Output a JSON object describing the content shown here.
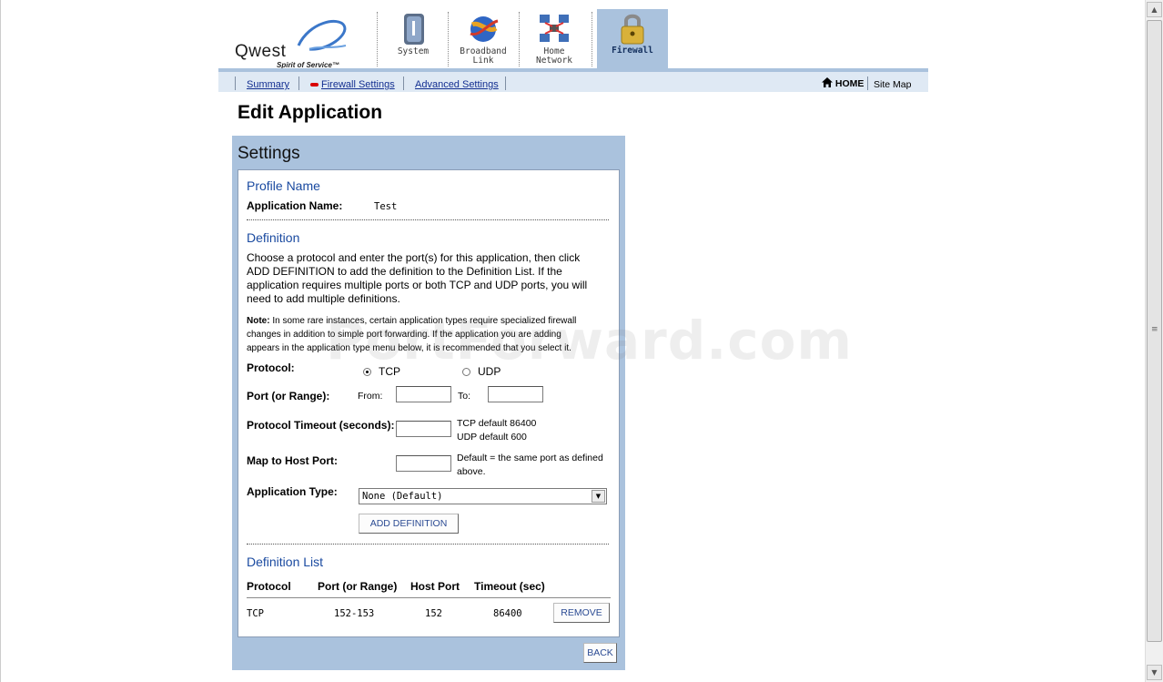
{
  "brand": {
    "logo_text": "Qwest",
    "tagline": "Spirit of Service™",
    "accent": "#aac2dd"
  },
  "tabs": [
    {
      "label_line1": "System",
      "label_line2": "",
      "icon": "system-icon"
    },
    {
      "label_line1": "Broadband",
      "label_line2": "Link",
      "icon": "globe-icon"
    },
    {
      "label_line1": "Home",
      "label_line2": "Network",
      "icon": "network-icon"
    },
    {
      "label_line1": "Firewall",
      "label_line2": "",
      "icon": "lock-icon",
      "active": true
    }
  ],
  "nav": {
    "summary": "Summary",
    "firewall_settings": "Firewall Settings",
    "advanced_settings": "Advanced Settings",
    "home": "HOME",
    "site_map": "Site Map"
  },
  "page_title": "Edit Application",
  "panel": {
    "title": "Settings",
    "profile": {
      "heading": "Profile Name",
      "app_name_label": "Application Name:",
      "app_name_value": "Test"
    },
    "definition": {
      "heading": "Definition",
      "para_lines": [
        "Choose a protocol and enter the port(s) for this application, then click",
        "ADD DEFINITION to add the definition to the Definition List. If the",
        "application requires multiple ports or both TCP and UDP ports, you will",
        "need to add multiple definitions."
      ],
      "note_label": "Note:",
      "note_lines": [
        " In some rare instances, certain application types require specialized firewall",
        "changes in addition to simple port forwarding. If the application you are adding",
        "appears in the application type menu below, it is recommended that you select it."
      ],
      "protocol_label": "Protocol:",
      "tcp": "TCP",
      "udp": "UDP",
      "port_label": "Port (or Range):",
      "from": "From:",
      "to": "To:",
      "timeout_label": "Protocol Timeout (seconds):",
      "timeout_hint1": "TCP default 86400",
      "timeout_hint2": "UDP default 600",
      "map_label": "Map to Host Port:",
      "map_hint1": "Default = the same port as defined",
      "map_hint2": "above.",
      "app_type_label": "Application Type:",
      "app_type_value": "None (Default)",
      "add_button": "ADD DEFINITION"
    },
    "list": {
      "heading": "Definition List",
      "columns": [
        "Protocol",
        "Port (or Range)",
        "Host Port",
        "Timeout (sec)"
      ],
      "rows": [
        {
          "protocol": "TCP",
          "port": "152-153",
          "host_port": "152",
          "timeout": "86400",
          "action": "REMOVE"
        }
      ]
    },
    "back_button": "BACK"
  },
  "watermark": "PortForward.com"
}
